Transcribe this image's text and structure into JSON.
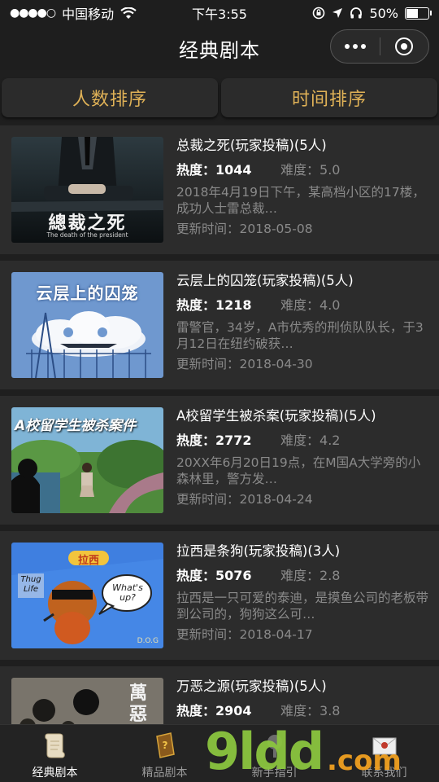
{
  "status_bar": {
    "carrier": "中国移动",
    "time": "下午3:55",
    "battery": "50%",
    "battery_level": 0.5
  },
  "nav": {
    "title": "经典剧本"
  },
  "sort": {
    "by_count": "人数排序",
    "by_time": "时间排序"
  },
  "labels": {
    "hot": "热度：",
    "difficulty": "难度："
  },
  "scripts": [
    {
      "title": "总裁之死(玩家投稿)(5人)",
      "hot": "1044",
      "difficulty": "5.0",
      "desc": "2018年4月19日下午，某高档小区的17楼，成功人士雷总裁…",
      "updated": "更新时间：2018-05-08",
      "thumb_text": "總裁之死",
      "thumb_sub": "The death of the president"
    },
    {
      "title": "云层上的囚笼(玩家投稿)(5人)",
      "hot": "1218",
      "difficulty": "4.0",
      "desc": "雷警官，34岁，A市优秀的刑侦队队长，于3月12日在纽约破获…",
      "updated": "更新时间：2018-04-30",
      "thumb_text": "云层上的囚笼"
    },
    {
      "title": "A校留学生被杀案(玩家投稿)(5人)",
      "hot": "2772",
      "difficulty": "4.2",
      "desc": "20XX年6月20日19点，在M国A大学旁的小森林里，警方发…",
      "updated": "更新时间：2018-04-24",
      "thumb_text": "A校留学生被杀案件"
    },
    {
      "title": "拉西是条狗(玩家投稿)(3人)",
      "hot": "5076",
      "difficulty": "2.8",
      "desc": "拉西是一只可爱的泰迪，是摸鱼公司的老板带到公司的，狗狗这么可…",
      "updated": "更新时间：2018-04-17",
      "thumb_text": "拉西",
      "thumb_bubble": "What's up?",
      "thumb_sign": "Thug Life",
      "thumb_corner": "D.O.G"
    },
    {
      "title": "万恶之源(玩家投稿)(5人)",
      "hot": "2904",
      "difficulty": "3.8",
      "desc": "",
      "updated": "",
      "thumb_text": "萬惡"
    }
  ],
  "tabs": [
    {
      "label": "经典剧本",
      "icon": "scroll-icon",
      "active": true
    },
    {
      "label": "精品剧本",
      "icon": "book-icon",
      "active": false
    },
    {
      "label": "新手指引",
      "icon": "guide-icon",
      "active": false
    },
    {
      "label": "联系我们",
      "icon": "envelope-icon",
      "active": false
    }
  ],
  "watermark": {
    "text": "9ldd",
    "suffix": ".com"
  },
  "colors": {
    "accent": "#e0b257",
    "watermark_green": "#8bc53f"
  }
}
